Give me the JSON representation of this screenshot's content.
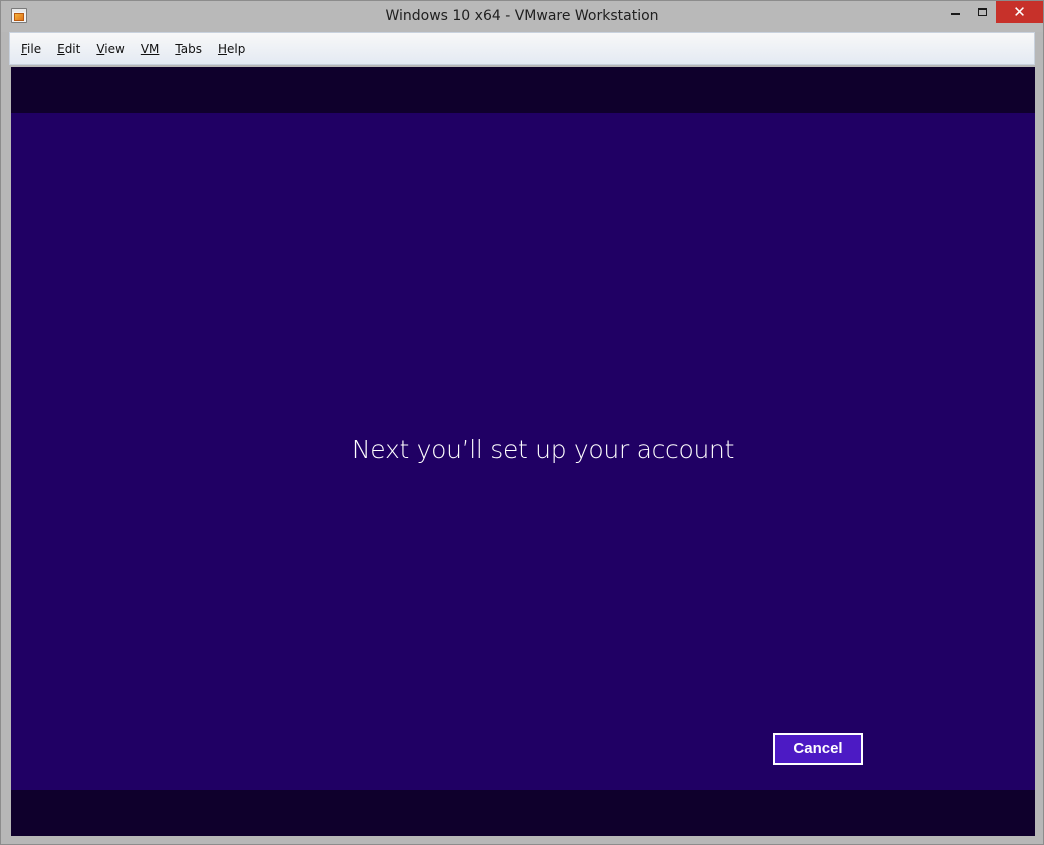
{
  "window": {
    "title": "Windows 10 x64 - VMware Workstation",
    "icon": "vmware-app-icon",
    "controls": {
      "minimize": "minimize-icon",
      "maximize": "maximize-icon",
      "close": "✕"
    }
  },
  "menubar": {
    "items": [
      {
        "mnemonic": "F",
        "rest": "ile"
      },
      {
        "mnemonic": "E",
        "rest": "dit"
      },
      {
        "mnemonic": "V",
        "rest": "iew"
      },
      {
        "mnemonic": "VM",
        "rest": ""
      },
      {
        "mnemonic": "T",
        "rest": "abs"
      },
      {
        "mnemonic": "H",
        "rest": "elp"
      }
    ]
  },
  "guest": {
    "headline": "Next you’ll set up your account",
    "cancel_label": "Cancel",
    "colors": {
      "background": "#200064",
      "letterbox": "#0f002c",
      "button": "#4c1ac4"
    }
  }
}
